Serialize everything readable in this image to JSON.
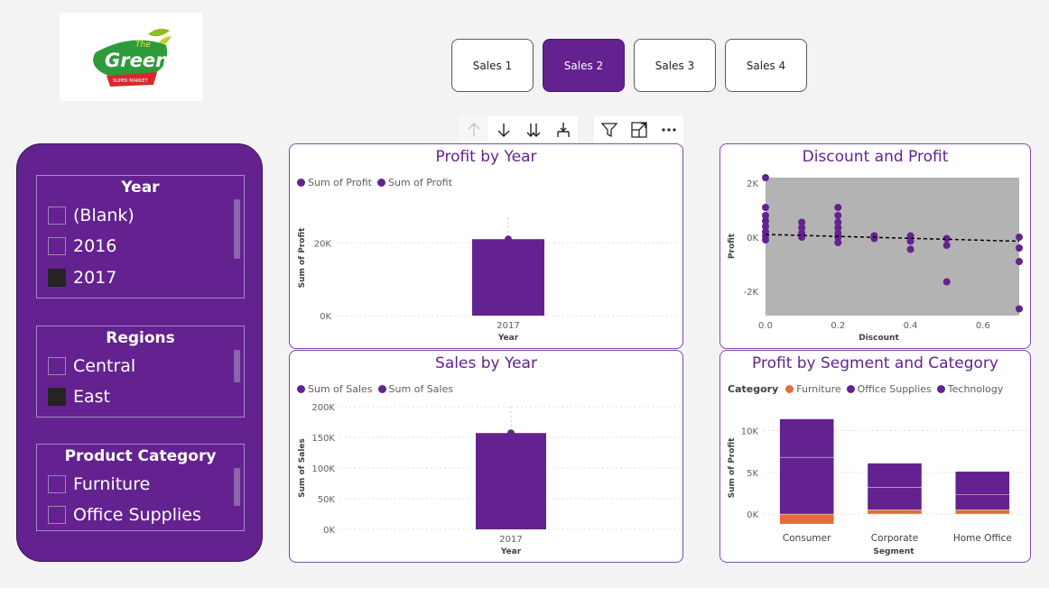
{
  "logo": {
    "brand_small": "The",
    "brand_main": "Green",
    "brand_sub": "SUPER MARKET"
  },
  "nav": {
    "buttons": [
      "Sales 1",
      "Sales 2",
      "Sales 3",
      "Sales 4"
    ],
    "active_index": 1
  },
  "toolbar": {
    "icons": [
      "arrow-up-icon",
      "arrow-down-icon",
      "double-arrow-down-icon",
      "expand-hierarchy-icon",
      "filter-icon",
      "focus-mode-icon",
      "more-options-icon"
    ]
  },
  "slicers": {
    "year": {
      "title": "Year",
      "items": [
        {
          "label": "(Blank)",
          "checked": false
        },
        {
          "label": "2016",
          "checked": false
        },
        {
          "label": "2017",
          "checked": true
        }
      ]
    },
    "regions": {
      "title": "Regions",
      "items": [
        {
          "label": "Central",
          "checked": false
        },
        {
          "label": "East",
          "checked": true
        }
      ]
    },
    "category": {
      "title": "Product Category",
      "items": [
        {
          "label": "Furniture",
          "checked": false
        },
        {
          "label": "Office Supplies",
          "checked": false
        }
      ]
    }
  },
  "colors": {
    "accent": "#63228f",
    "furniture": "#e66c37",
    "plot_bg": "#b3b3b3"
  },
  "profit_by_year": {
    "title": "Profit by Year",
    "legend": [
      "Sum of Profit",
      "Sum of Profit"
    ],
    "chart_data": {
      "type": "bar",
      "categories": [
        "2017"
      ],
      "values": [
        21000
      ],
      "ticks": [
        "20K",
        "0K"
      ],
      "ylim": [
        0,
        27000
      ],
      "xlabel": "Year",
      "ylabel": "Sum of Profit"
    }
  },
  "sales_by_year": {
    "title": "Sales by Year",
    "legend": [
      "Sum of Sales",
      "Sum of Sales"
    ],
    "chart_data": {
      "type": "bar",
      "categories": [
        "2017"
      ],
      "values": [
        157000
      ],
      "ticks": [
        "200K",
        "150K",
        "100K",
        "50K",
        "0K"
      ],
      "ylim": [
        0,
        200000
      ],
      "xlabel": "Year",
      "ylabel": "Sum of Sales"
    }
  },
  "discount_profit": {
    "title": "Discount and Profit",
    "chart_data": {
      "type": "scatter",
      "xlabel": "Discount",
      "ylabel": "Profit",
      "xticks": [
        "0.0",
        "0.2",
        "0.4",
        "0.6"
      ],
      "yticks": [
        "2K",
        "0K",
        "-2K"
      ],
      "xlim": [
        0,
        0.7
      ],
      "ylim": [
        -2900,
        2200
      ],
      "points": [
        [
          0,
          2200
        ],
        [
          0,
          1100
        ],
        [
          0,
          800
        ],
        [
          0,
          600
        ],
        [
          0,
          400
        ],
        [
          0,
          200
        ],
        [
          0,
          50
        ],
        [
          0,
          -100
        ],
        [
          0.1,
          550
        ],
        [
          0.1,
          350
        ],
        [
          0.1,
          150
        ],
        [
          0.1,
          0
        ],
        [
          0.2,
          1100
        ],
        [
          0.2,
          800
        ],
        [
          0.2,
          550
        ],
        [
          0.2,
          350
        ],
        [
          0.2,
          150
        ],
        [
          0.2,
          0
        ],
        [
          0.2,
          -200
        ],
        [
          0.3,
          50
        ],
        [
          0.3,
          -50
        ],
        [
          0.4,
          50
        ],
        [
          0.4,
          -150
        ],
        [
          0.4,
          -450
        ],
        [
          0.5,
          -50
        ],
        [
          0.5,
          -300
        ],
        [
          0.5,
          -1650
        ],
        [
          0.7,
          0
        ],
        [
          0.7,
          -400
        ],
        [
          0.7,
          -900
        ],
        [
          0.7,
          -2650
        ]
      ],
      "trend": [
        [
          0,
          100
        ],
        [
          0.7,
          -150
        ]
      ]
    }
  },
  "segment_category": {
    "title": "Profit by Segment and Category",
    "legend_title": "Category",
    "chart_data": {
      "type": "bar",
      "stacked": true,
      "categories": [
        "Consumer",
        "Corporate",
        "Home Office"
      ],
      "series": [
        {
          "name": "Furniture",
          "values": [
            -1200,
            500,
            500
          ]
        },
        {
          "name": "Office Supplies",
          "values": [
            6800,
            2700,
            1800
          ]
        },
        {
          "name": "Technology",
          "values": [
            4600,
            2900,
            2800
          ]
        }
      ],
      "yticks": [
        "10K",
        "5K",
        "0K"
      ],
      "ylim": [
        -1400,
        12000
      ],
      "xlabel": "Segment",
      "ylabel": "Sum of Profit"
    }
  }
}
